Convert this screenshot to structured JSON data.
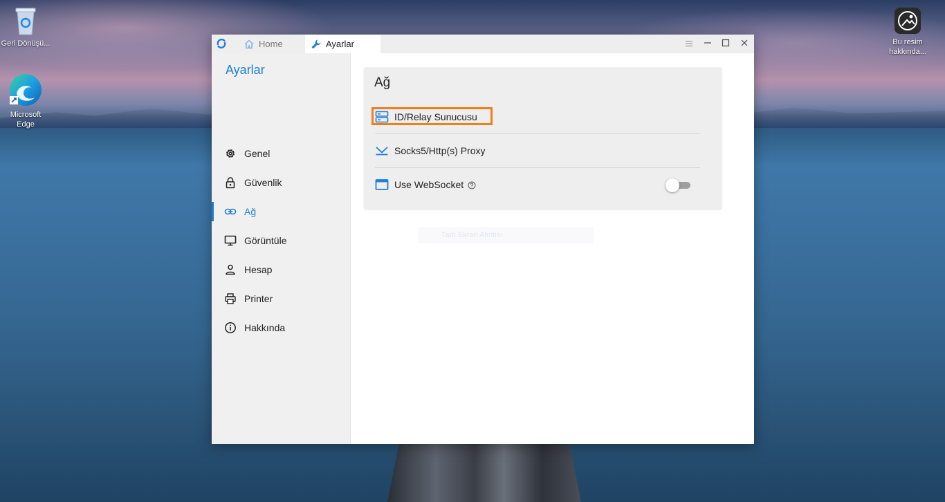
{
  "desktop": {
    "icons": [
      {
        "label": "Geri Dönüşü...",
        "icon": "recycle-bin-icon"
      },
      {
        "label": "Microsoft Edge",
        "icon": "edge-icon"
      },
      {
        "label": "Bu resim hakkında...",
        "icon": "camera-info-icon"
      }
    ]
  },
  "window": {
    "tabs": [
      {
        "label": "Home",
        "icon": "home-icon"
      },
      {
        "label": "Ayarlar",
        "icon": "wrench-icon"
      }
    ],
    "controls": [
      "menu-icon",
      "minimize-icon",
      "maximize-icon",
      "close-icon"
    ]
  },
  "sidebar": {
    "title": "Ayarlar",
    "items": [
      {
        "label": "Genel",
        "icon": "gear-icon"
      },
      {
        "label": "Güvenlik",
        "icon": "lock-icon"
      },
      {
        "label": "Ağ",
        "icon": "link-icon",
        "active": true
      },
      {
        "label": "Görüntüle",
        "icon": "monitor-icon"
      },
      {
        "label": "Hesap",
        "icon": "user-icon"
      },
      {
        "label": "Printer",
        "icon": "printer-icon"
      },
      {
        "label": "Hakkında",
        "icon": "info-icon"
      }
    ]
  },
  "content": {
    "card_title": "Ağ",
    "rows": [
      {
        "label": "ID/Relay Sunucusu",
        "icon": "server-icon",
        "highlighted": true
      },
      {
        "label": "Socks5/Http(s) Proxy",
        "icon": "proxy-icon"
      },
      {
        "label": "Use WebSocket",
        "icon": "websocket-icon",
        "toggle": false
      }
    ],
    "ghost_text": "Tam Ekran Alıntısı"
  },
  "colors": {
    "accent": "#1f7ed6",
    "highlight": "#f07e1b",
    "sidebar_bg": "#f0f0f0",
    "card_bg": "#eeeeee"
  }
}
